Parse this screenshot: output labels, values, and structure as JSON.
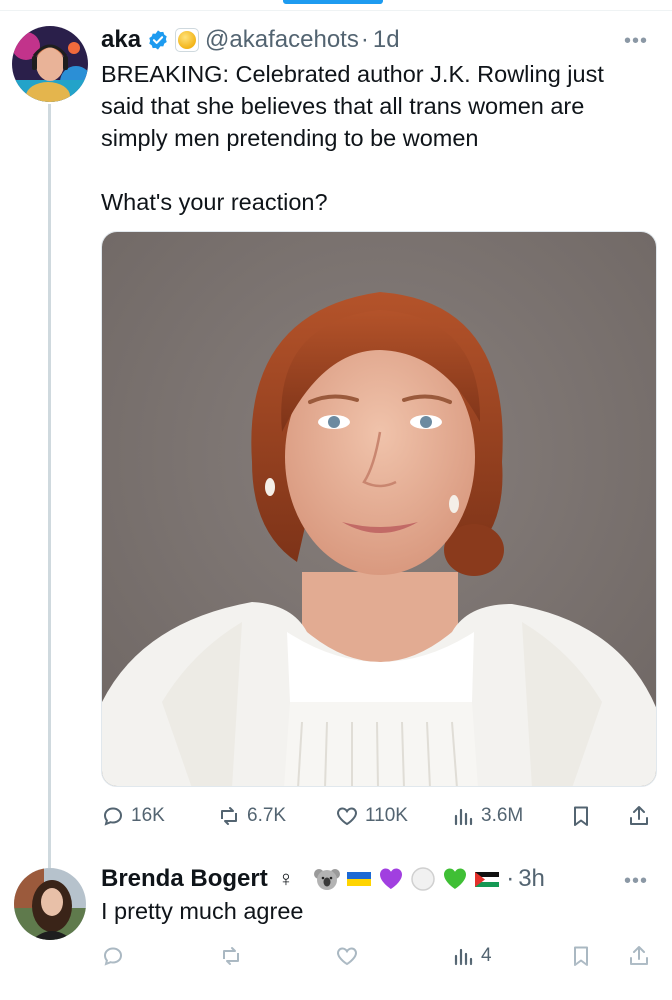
{
  "tweet": {
    "author_name": "aka",
    "handle": "@akafacehots",
    "separator": "·",
    "time": "1d",
    "more_icon": "more-horizontal-icon",
    "text_lines": [
      "BREAKING: Celebrated author J.K. Rowling just",
      "said that she believes that all trans women are",
      "simply men pretending to be women"
    ],
    "text_question": "What's your reaction?",
    "media": {
      "description_icon": "portrait-photo"
    },
    "actions": {
      "replies": "16K",
      "reposts": "6.7K",
      "likes": "110K",
      "views": "3.6M"
    }
  },
  "reply": {
    "author_name": "Brenda Bogert",
    "gender_symbol": "♀",
    "emoji_icons": [
      "koala-icon",
      "ukraine-flag-icon",
      "purple-heart-icon",
      "white-circle-icon",
      "green-heart-icon",
      "palestine-flag-icon"
    ],
    "separator": "·",
    "time": "3h",
    "text": "I pretty much agree",
    "views": "4"
  },
  "colors": {
    "accent": "#1d9bf0",
    "text": "#0f1419",
    "secondary": "#536471",
    "thread_line": "#cfd9de"
  }
}
